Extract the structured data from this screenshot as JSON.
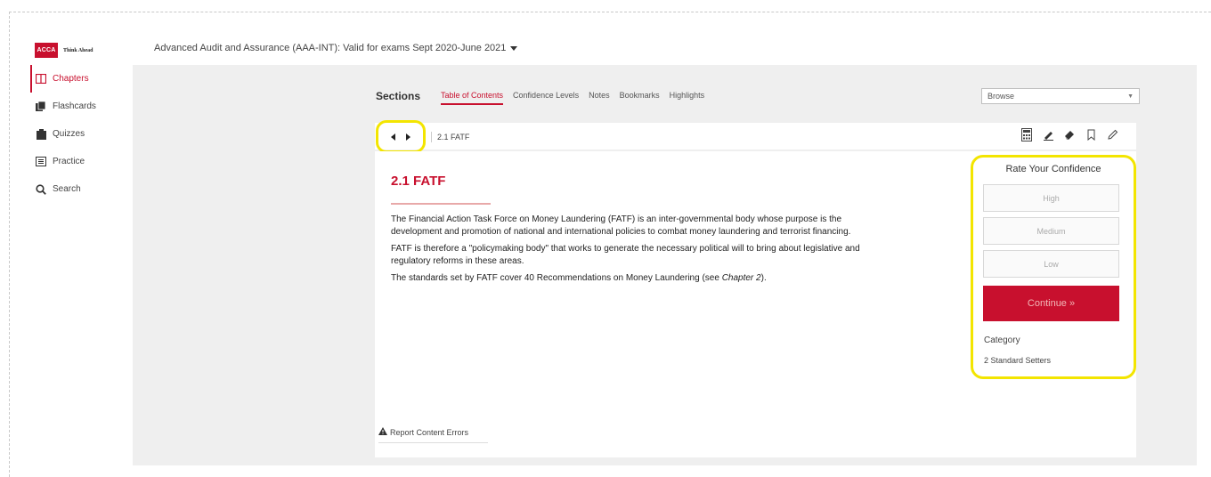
{
  "logo": {
    "badge": "ACCA",
    "tagline": "Think Ahead"
  },
  "sidebar": {
    "items": [
      {
        "label": "Chapters",
        "icon": "book-icon",
        "active": true
      },
      {
        "label": "Flashcards",
        "icon": "flashcards-icon",
        "active": false
      },
      {
        "label": "Quizzes",
        "icon": "quiz-icon",
        "active": false
      },
      {
        "label": "Practice",
        "icon": "practice-icon",
        "active": false
      },
      {
        "label": "Search",
        "icon": "search-icon",
        "active": false
      }
    ]
  },
  "header": {
    "course_title": "Advanced Audit and Assurance (AAA-INT): Valid for exams Sept 2020-June 2021"
  },
  "tabs": {
    "sections_label": "Sections",
    "items": [
      {
        "label": "Table of Contents",
        "active": true
      },
      {
        "label": "Confidence Levels",
        "active": false
      },
      {
        "label": "Notes",
        "active": false
      },
      {
        "label": "Bookmarks",
        "active": false
      },
      {
        "label": "Highlights",
        "active": false
      }
    ],
    "browse_value": "Browse"
  },
  "toolbar": {
    "breadcrumb": "2.1 FATF",
    "tools": [
      "calculator-icon",
      "highlighter-icon",
      "eraser-icon",
      "bookmark-icon",
      "pencil-icon"
    ]
  },
  "content": {
    "heading": "2.1 FATF",
    "paragraphs": [
      "The Financial Action Task Force on Money Laundering (FATF) is an inter-governmental body whose purpose is the development and promotion of national and international policies to combat money laundering and terrorist financing.",
      "FATF is therefore a \"policymaking body\" that works to generate the necessary political will to bring about legislative and regulatory reforms in these areas.",
      "The standards set by FATF cover 40 Recommendations on Money Laundering (see "
    ],
    "chapter_ref": "Chapter 2",
    "closing": ").",
    "report_label": "Report Content Errors"
  },
  "confidence": {
    "title": "Rate Your Confidence",
    "options": [
      "High",
      "Medium",
      "Low"
    ],
    "continue_label": "Continue »",
    "category_label": "Category",
    "category_value": "2 Standard Setters"
  },
  "colors": {
    "brand": "#c8102e",
    "highlight": "#f3e500",
    "panel": "#efefef"
  }
}
